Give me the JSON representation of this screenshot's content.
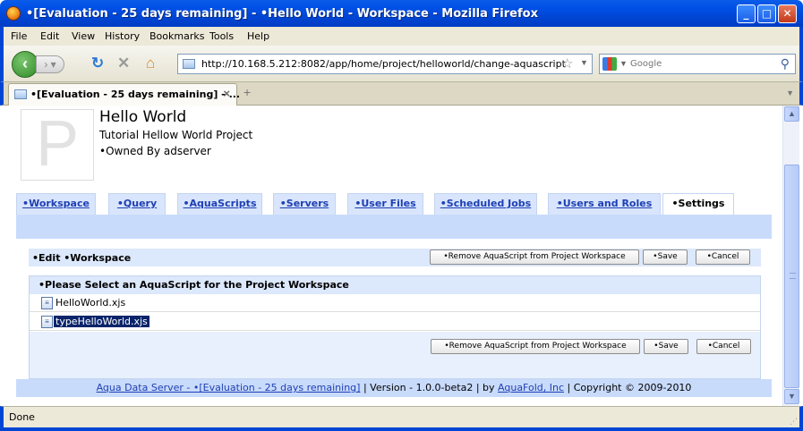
{
  "window": {
    "title": "•[Evaluation - 25 days remaining] - •Hello World - Workspace - Mozilla Firefox",
    "minimize": "_",
    "maximize": "□",
    "close": "✕"
  },
  "menu": [
    "File",
    "Edit",
    "View",
    "History",
    "Bookmarks",
    "Tools",
    "Help"
  ],
  "nav": {
    "url": "http://10.168.5.212:8082/app/home/project/helloworld/change-aquascript",
    "search_placeholder": "Google"
  },
  "browser_tab": {
    "label": "•[Evaluation - 25 days remaining] - ..."
  },
  "project": {
    "logo_letter": "P",
    "title": "Hello World",
    "description": "Tutorial Hellow World Project",
    "owner": "•Owned By adserver"
  },
  "app_tabs": [
    {
      "label": "•Workspace"
    },
    {
      "label": "•Query"
    },
    {
      "label": "•AquaScripts"
    },
    {
      "label": "•Servers"
    },
    {
      "label": "•User Files"
    },
    {
      "label": "•Scheduled Jobs"
    },
    {
      "label": "•Users and Roles"
    },
    {
      "label": "•Settings"
    }
  ],
  "panel": {
    "edit_label": "•Edit •Workspace",
    "remove_button": "•Remove AquaScript from Project Workspace",
    "save_button": "•Save",
    "cancel_button": "•Cancel",
    "list_header": "•Please Select an AquaScript for the Project Workspace",
    "files": [
      {
        "name": "HelloWorld.xjs",
        "selected": false
      },
      {
        "name": "typeHelloWorld.xjs",
        "selected": true
      }
    ]
  },
  "footer": {
    "server_link": "Aqua Data Server - •[Evaluation - 25 days remaining]",
    "version": "| Version - 1.0.0-beta2 | by",
    "company_link": "AquaFold, Inc",
    "copyright": "| Copyright © 2009-2010"
  },
  "status": {
    "text": "Done"
  }
}
